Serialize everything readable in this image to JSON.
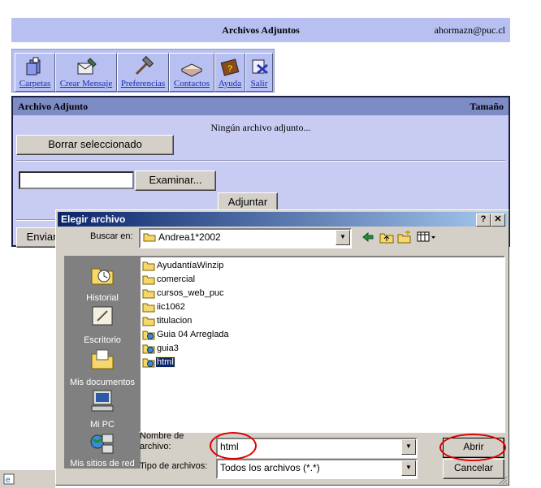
{
  "webmail": {
    "title": "Archivos Adjuntos",
    "user": "ahormazn@puc.cl",
    "toolbar": [
      {
        "label": "Carpetas",
        "icon": "folders-icon"
      },
      {
        "label": "Crear Mensaje",
        "icon": "compose-icon"
      },
      {
        "label": "Preferencias",
        "icon": "tools-icon"
      },
      {
        "label": "Contactos",
        "icon": "address-book-icon"
      },
      {
        "label": "Ayuda",
        "icon": "help-book-icon"
      },
      {
        "label": "Salir",
        "icon": "exit-icon"
      }
    ],
    "attachments": {
      "col_name": "Archivo Adjunto",
      "col_size": "Tamaño",
      "empty_message": "Ningún archivo adjunto...",
      "delete_button": "Borrar seleccionado",
      "file_input_value": "",
      "browse_button": "Examinar...",
      "attach_button": "Adjuntar",
      "send_button": "Enviar"
    }
  },
  "dialog": {
    "title": "Elegir archivo",
    "help_btn": "?",
    "close_btn": "✕",
    "look_in_label": "Buscar en:",
    "look_in_value": "Andrea1*2002",
    "places": [
      {
        "label": "Historial",
        "icon": "history-icon"
      },
      {
        "label": "Escritorio",
        "icon": "desktop-icon"
      },
      {
        "label": "Mis documentos",
        "icon": "my-documents-icon"
      },
      {
        "label": "Mi PC",
        "icon": "my-computer-icon"
      },
      {
        "label": "Mis sitios de red",
        "icon": "network-places-icon"
      }
    ],
    "files": [
      {
        "name": "AyudantíaWinzip",
        "type": "folder"
      },
      {
        "name": "comercial",
        "type": "folder"
      },
      {
        "name": "cursos_web_puc",
        "type": "folder"
      },
      {
        "name": "iic1062",
        "type": "folder"
      },
      {
        "name": "titulacion",
        "type": "folder"
      },
      {
        "name": "Guia 04 Arreglada",
        "type": "web-folder"
      },
      {
        "name": "guia3",
        "type": "web-folder"
      },
      {
        "name": "html",
        "type": "web-folder",
        "selected": true
      }
    ],
    "filename_label": "Nombre de archivo:",
    "filename_value": "html",
    "filetype_label": "Tipo de archivos:",
    "filetype_value": "Todos los archivos (*.*)",
    "open_button": "Abrir",
    "cancel_button": "Cancelar"
  },
  "colors": {
    "header_bg": "#b7c0f0",
    "panel_bg": "#c9ccf2",
    "panel_bar": "#7e8cc6",
    "dialog_title": "#0a246a",
    "highlight": "#dd0000"
  }
}
